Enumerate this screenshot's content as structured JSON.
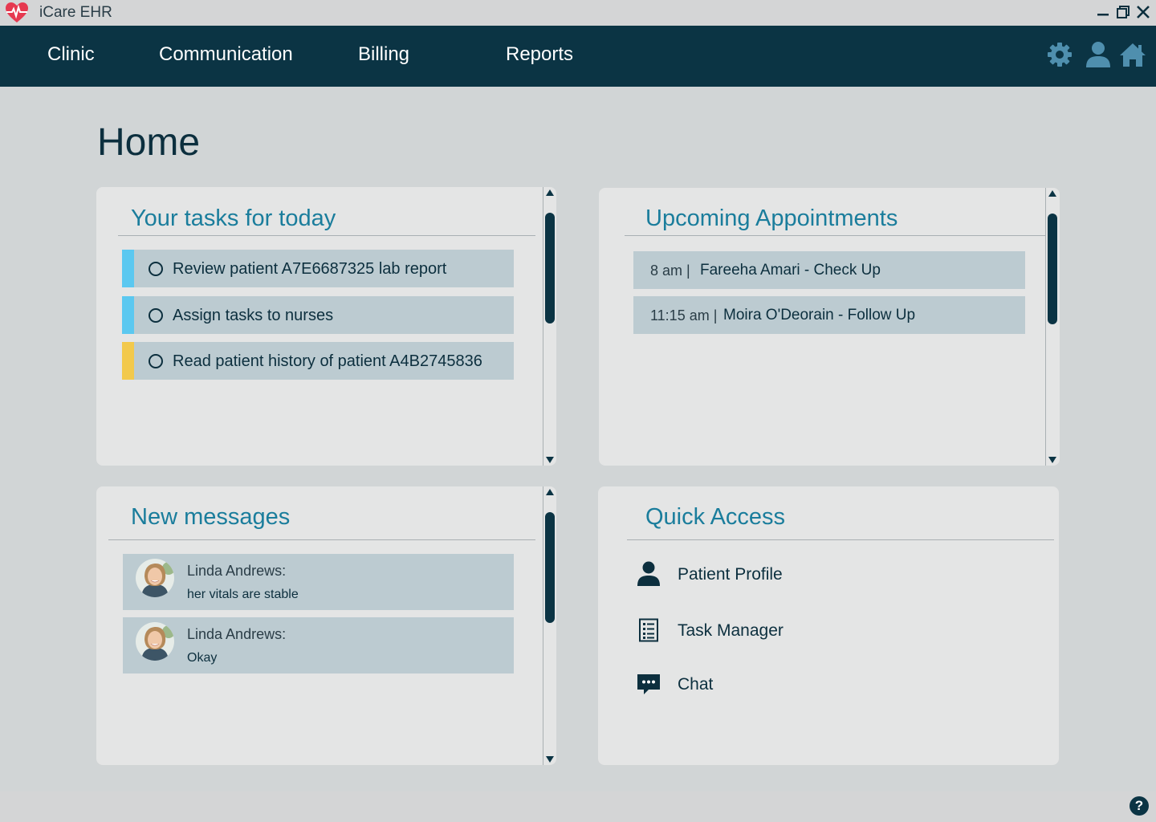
{
  "window": {
    "title": "iCare EHR"
  },
  "nav": {
    "items": [
      {
        "label": "Clinic"
      },
      {
        "label": "Communication"
      },
      {
        "label": "Billing"
      },
      {
        "label": "Reports"
      }
    ],
    "icons": [
      "gear-icon",
      "user-icon",
      "home-icon"
    ]
  },
  "page": {
    "title": "Home"
  },
  "tasks": {
    "title": "Your tasks for today",
    "items": [
      {
        "text": "Review patient A7E6687325 lab report",
        "color": "#5bc8f0"
      },
      {
        "text": "Assign tasks to nurses",
        "color": "#5bc8f0"
      },
      {
        "text": "Read patient history of patient A4B2745836",
        "color": "#f2c94c"
      }
    ]
  },
  "appointments": {
    "title": "Upcoming Appointments",
    "items": [
      {
        "time": "8 am  |",
        "name": "Fareeha Amari - Check Up"
      },
      {
        "time": "11:15 am |",
        "name": "Moira O'Deorain - Follow Up"
      }
    ]
  },
  "messages": {
    "title": "New messages",
    "items": [
      {
        "sender": "Linda Andrews:",
        "text": "her vitals are stable"
      },
      {
        "sender": "Linda Andrews:",
        "text": "Okay"
      }
    ]
  },
  "quick_access": {
    "title": "Quick Access",
    "items": [
      {
        "label": "Patient Profile",
        "icon": "person-icon"
      },
      {
        "label": "Task Manager",
        "icon": "checklist-icon"
      },
      {
        "label": "Chat",
        "icon": "chat-icon"
      }
    ]
  },
  "footer": {
    "help": "?"
  },
  "colors": {
    "navbar": "#0b3444",
    "accent": "#1a7d9c",
    "row": "#bccbd1",
    "panel": "#e4e5e5",
    "background": "#d1d5d6"
  }
}
